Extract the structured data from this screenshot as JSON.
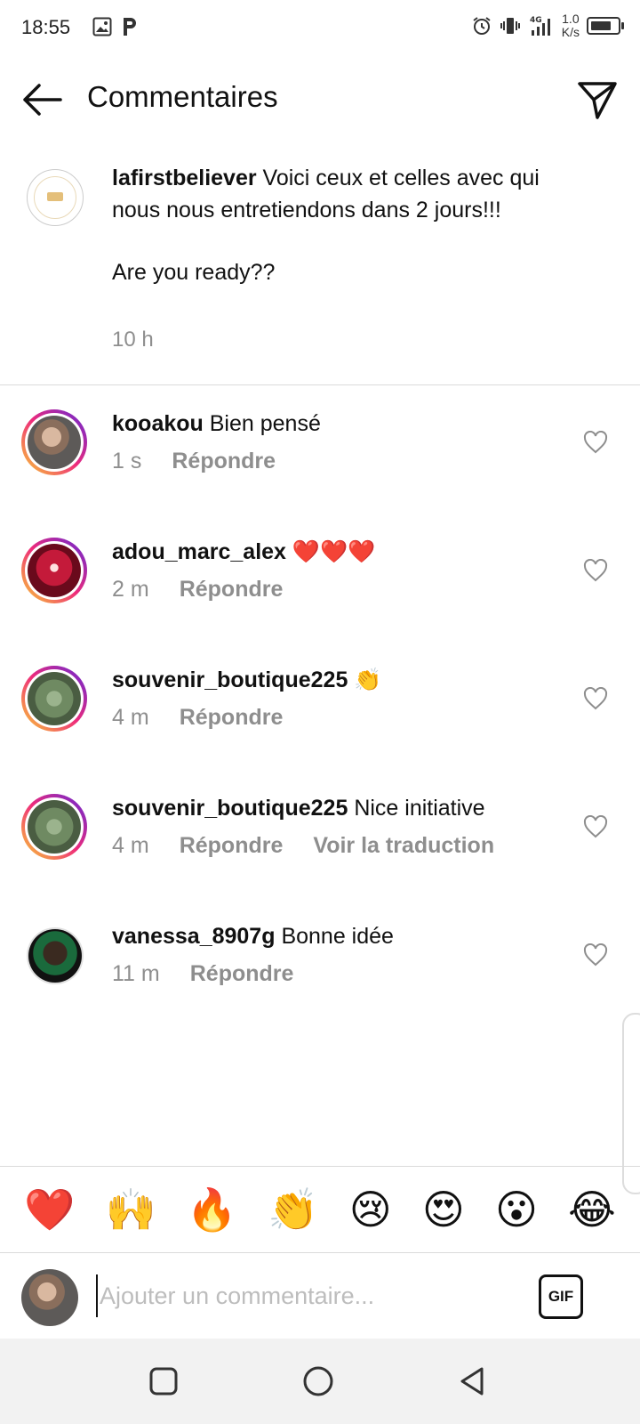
{
  "status_bar": {
    "time": "18:55",
    "network": "4G",
    "speed_value": "1.0",
    "speed_unit": "K/s"
  },
  "header": {
    "title": "Commentaires",
    "back_icon": "arrow-left-icon",
    "share_icon": "paper-plane-icon"
  },
  "caption": {
    "username": "lafirstbeliever",
    "text_line1": "Voici ceux et celles avec qui nous nous entretiendons dans 2 jours!!!",
    "text_line2": "Are you ready??",
    "time": "10 h"
  },
  "comments": [
    {
      "username": "kooakou",
      "text": "Bien pensé",
      "time": "1 s",
      "reply": "Répondre",
      "translate": ""
    },
    {
      "username": "adou_marc_alex",
      "text": "❤️❤️❤️",
      "time": "2 m",
      "reply": "Répondre",
      "translate": ""
    },
    {
      "username": "souvenir_boutique225",
      "text": "👏",
      "time": "4 m",
      "reply": "Répondre",
      "translate": ""
    },
    {
      "username": "souvenir_boutique225",
      "text": "Nice initiative",
      "time": "4 m",
      "reply": "Répondre",
      "translate": "Voir la traduction"
    },
    {
      "username": "vanessa_8907g",
      "text": "Bonne idée",
      "time": "11 m",
      "reply": "Répondre",
      "translate": ""
    }
  ],
  "emoji_bar": [
    "❤️",
    "🙌",
    "🔥",
    "👏",
    "😢",
    "😍",
    "😮",
    "😂"
  ],
  "composer": {
    "placeholder": "Ajouter un commentaire...",
    "gif_label": "GIF"
  },
  "colors": {
    "secondary_text": "#8e8e8e",
    "divider": "#dbdbdb",
    "nav_bg": "#f2f2f2"
  }
}
